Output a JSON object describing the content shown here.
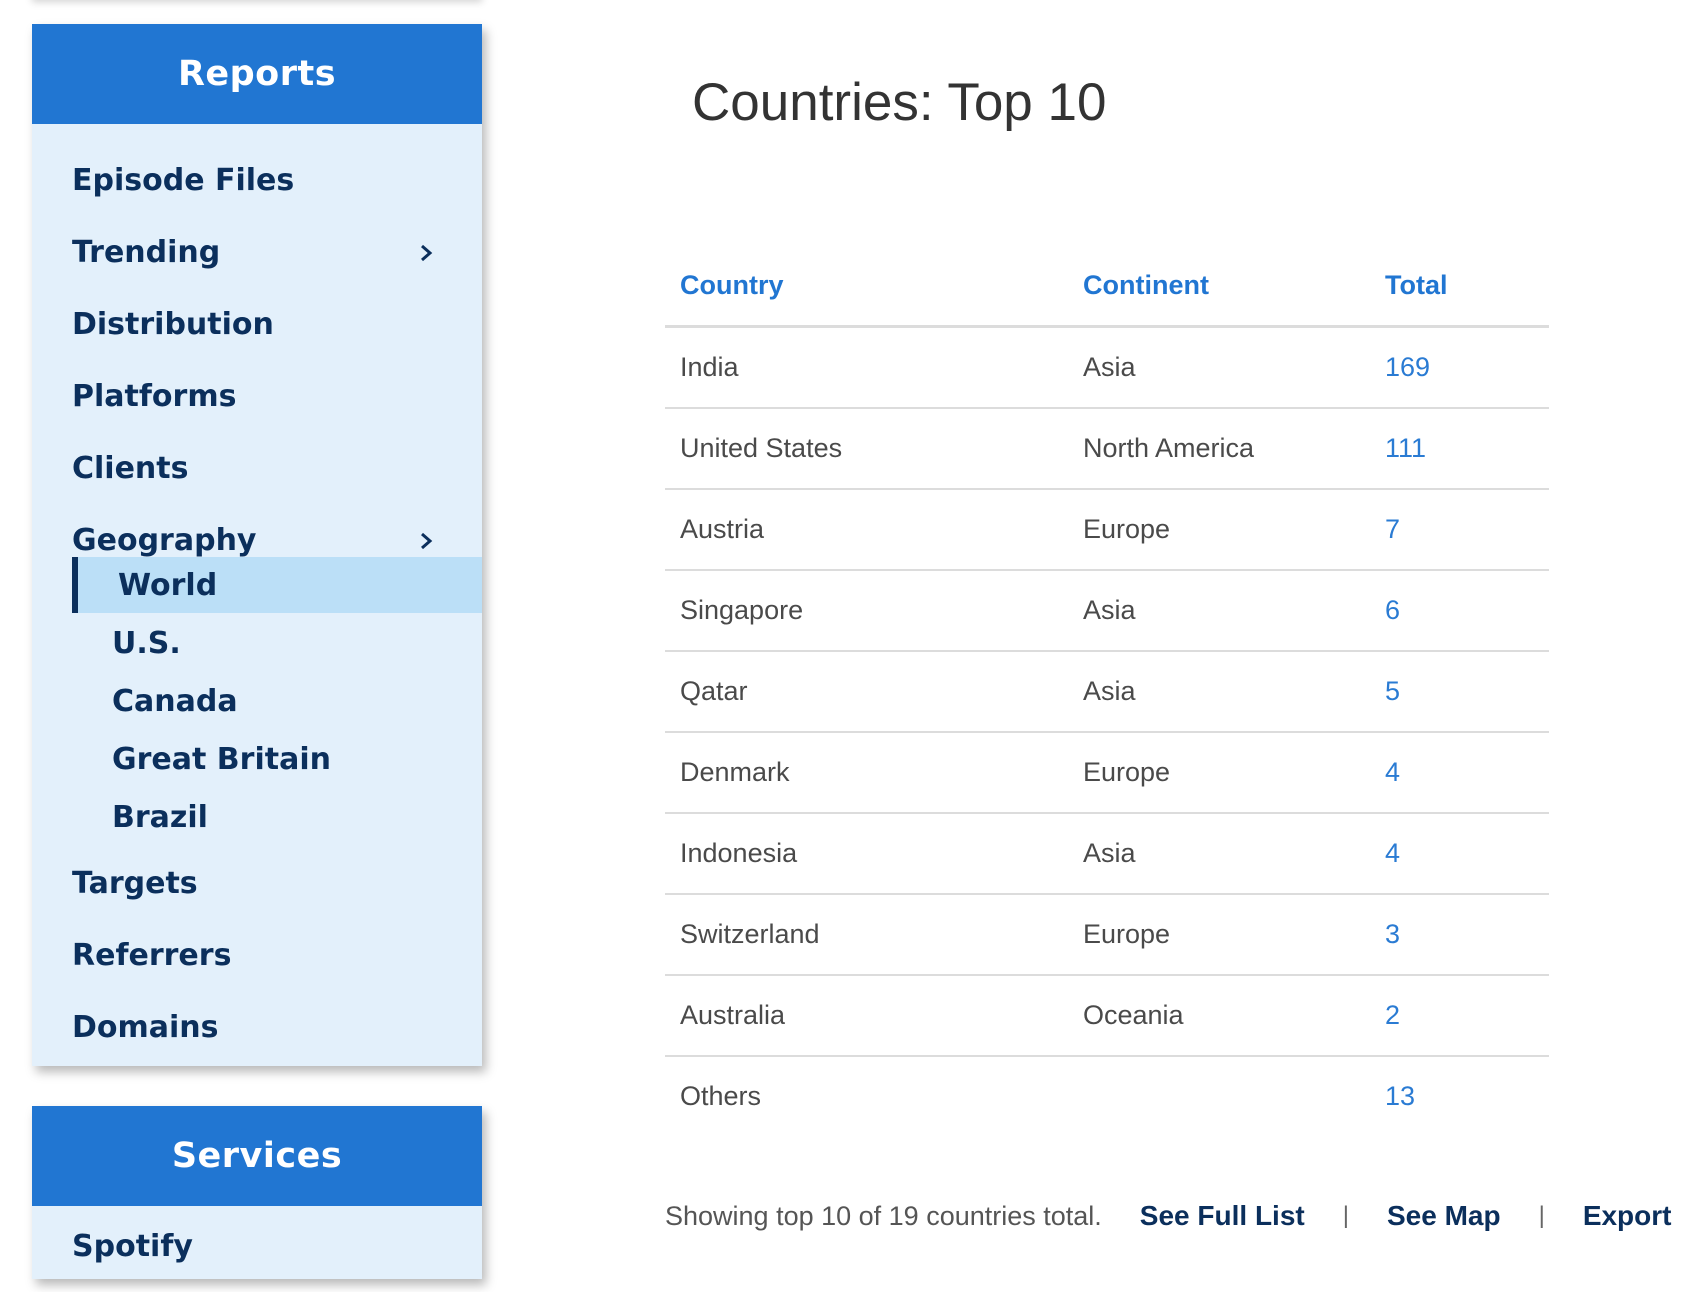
{
  "sidebar": {
    "reports": {
      "header": "Reports",
      "items": [
        {
          "label": "Episode Files"
        },
        {
          "label": "Trending"
        },
        {
          "label": "Distribution"
        },
        {
          "label": "Platforms"
        },
        {
          "label": "Clients"
        },
        {
          "label": "Geography"
        },
        {
          "label": "Targets"
        },
        {
          "label": "Referrers"
        },
        {
          "label": "Domains"
        }
      ],
      "geography_subitems": [
        {
          "label": "World",
          "active": true
        },
        {
          "label": "U.S."
        },
        {
          "label": "Canada"
        },
        {
          "label": "Great Britain"
        },
        {
          "label": "Brazil"
        }
      ]
    },
    "services": {
      "header": "Services",
      "items": [
        {
          "label": "Spotify"
        }
      ]
    }
  },
  "main": {
    "title": "Countries: Top 10",
    "table": {
      "headers": [
        "Country",
        "Continent",
        "Total"
      ],
      "rows": [
        [
          "India",
          "Asia",
          "169"
        ],
        [
          "United States",
          "North America",
          "111"
        ],
        [
          "Austria",
          "Europe",
          "7"
        ],
        [
          "Singapore",
          "Asia",
          "6"
        ],
        [
          "Qatar",
          "Asia",
          "5"
        ],
        [
          "Denmark",
          "Europe",
          "4"
        ],
        [
          "Indonesia",
          "Asia",
          "4"
        ],
        [
          "Switzerland",
          "Europe",
          "3"
        ],
        [
          "Australia",
          "Oceania",
          "2"
        ],
        [
          "Others",
          "",
          "13"
        ]
      ]
    },
    "footer": {
      "summary": "Showing top 10 of 19 countries total.",
      "see_full_list": "See Full List",
      "see_map": "See Map",
      "export": "Export",
      "separator": "|"
    }
  },
  "colors": {
    "accent": "#2176d2",
    "nav_text": "#0b2f5c",
    "panel_bg": "#e3f0fb",
    "active_bg": "#bbdff7"
  }
}
